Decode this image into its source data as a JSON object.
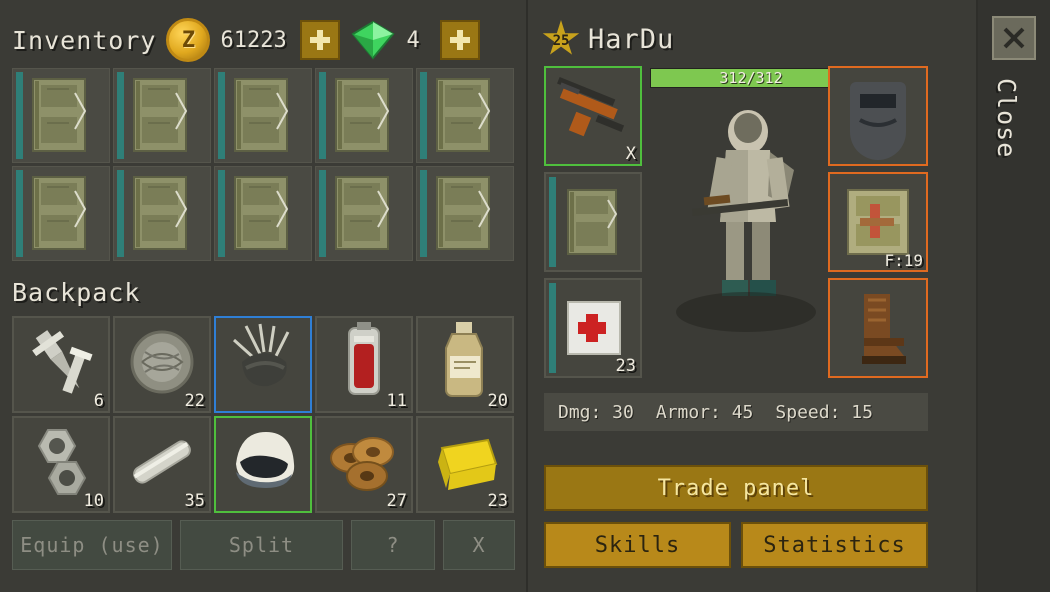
{
  "header": {
    "inventory_title": "Inventory",
    "coin_icon": "coin-icon",
    "coin_symbol": "Z",
    "coin_amount": "61223",
    "coin_plus_label": "+",
    "gem_icon": "gem-icon",
    "gem_amount": "4",
    "gem_plus_label": "+"
  },
  "inventory": {
    "slots": [
      {
        "icon": "backpack-icon",
        "count": ""
      },
      {
        "icon": "backpack-icon",
        "count": ""
      },
      {
        "icon": "backpack-icon",
        "count": ""
      },
      {
        "icon": "backpack-icon",
        "count": ""
      },
      {
        "icon": "backpack-icon",
        "count": ""
      },
      {
        "icon": "backpack-icon",
        "count": ""
      },
      {
        "icon": "backpack-icon",
        "count": ""
      },
      {
        "icon": "backpack-icon",
        "count": ""
      },
      {
        "icon": "backpack-icon",
        "count": ""
      },
      {
        "icon": "backpack-icon",
        "count": ""
      }
    ]
  },
  "backpack": {
    "label": "Backpack",
    "items": [
      {
        "icon": "screw-nail-icon",
        "count": "6",
        "selected": "none"
      },
      {
        "icon": "wire-coil-icon",
        "count": "22",
        "selected": "none"
      },
      {
        "icon": "spiked-helmet-icon",
        "count": "",
        "selected": "blue"
      },
      {
        "icon": "blood-bag-icon",
        "count": "11",
        "selected": "none"
      },
      {
        "icon": "medicine-bottle-icon",
        "count": "20",
        "selected": "none"
      },
      {
        "icon": "nuts-bolts-icon",
        "count": "10",
        "selected": "none"
      },
      {
        "icon": "metal-pipe-icon",
        "count": "35",
        "selected": "none"
      },
      {
        "icon": "motorcycle-helmet-icon",
        "count": "",
        "selected": "green"
      },
      {
        "icon": "bagels-food-icon",
        "count": "27",
        "selected": "none"
      },
      {
        "icon": "gold-bar-icon",
        "count": "23",
        "selected": "none"
      }
    ]
  },
  "actions": [
    {
      "label": "Equip (use)",
      "name": "equip-use-button",
      "enabled": false
    },
    {
      "label": "Split",
      "name": "split-button",
      "enabled": false
    },
    {
      "label": "?",
      "name": "help-button",
      "enabled": false
    },
    {
      "label": "X",
      "name": "drop-button",
      "enabled": false
    }
  ],
  "character": {
    "rank": "25",
    "name": "HarDu",
    "hp_current": 312,
    "hp_max": 312,
    "hp_text": "312/312",
    "hp_percent": 100
  },
  "quick_slots": [
    {
      "icon": "assault-rifle-icon",
      "count": "X",
      "selected": "green"
    },
    {
      "icon": "backpack-icon",
      "count": "",
      "selected": "none"
    },
    {
      "icon": "first-aid-kit-icon",
      "count": "23",
      "selected": "none"
    }
  ],
  "armor_slots": [
    {
      "icon": "welding-mask-icon",
      "count": ""
    },
    {
      "icon": "camo-backpack-icon",
      "count": "F:19"
    },
    {
      "icon": "leather-boots-icon",
      "count": ""
    }
  ],
  "stats": [
    {
      "label": "Dmg: 30"
    },
    {
      "label": "Armor: 45"
    },
    {
      "label": "Speed: 15"
    }
  ],
  "buttons": {
    "trade_panel": "Trade panel",
    "skills": "Skills",
    "statistics": "Statistics"
  },
  "close": {
    "label": "Close",
    "icon": "close-x-icon"
  },
  "colors": {
    "bg": "#33332f",
    "panel": "#3b3b36",
    "slot": "#45453e",
    "gold": "#9a7714",
    "gold_bright": "#b8891a",
    "hp_green": "#7ec850",
    "sel_green": "#4fbf3d",
    "sel_blue": "#2f7fd6",
    "armor_orange": "#e06a20",
    "teal": "#2f7f78",
    "text": "#e8e4d8"
  }
}
